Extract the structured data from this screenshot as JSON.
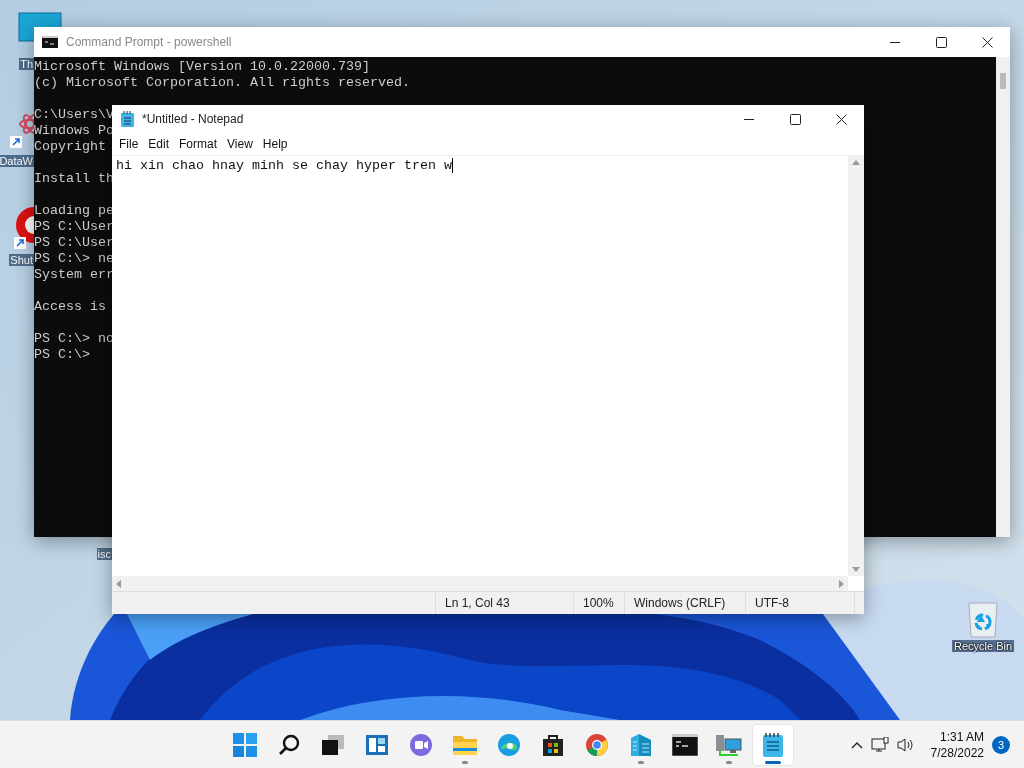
{
  "desktop_icons": [
    {
      "kind": "monitor",
      "label": "Th"
    },
    {
      "kind": "atom",
      "label": "DataW"
    },
    {
      "kind": "shutdown",
      "label": "Shut"
    },
    {
      "kind": "none",
      "label": "isc"
    },
    {
      "kind": "recycle",
      "label": "Recycle Bin"
    }
  ],
  "console_window": {
    "title": "Command Prompt - powershell",
    "blocks": [
      [
        "Microsoft Windows [Version 10.0.22000.739]",
        "(c) Microsoft Corporation. All rights reserved."
      ],
      [
        "C:\\Users\\V",
        "Windows Po",
        "Copyright"
      ],
      [
        "Install th"
      ],
      [
        "Loading pe",
        "PS C:\\User",
        "PS C:\\User",
        "PS C:\\> ne",
        "System err"
      ],
      [
        "Access is"
      ],
      [
        "PS C:\\> no",
        "PS C:\\>"
      ]
    ]
  },
  "notepad": {
    "title": "*Untitled - Notepad",
    "menu": [
      "File",
      "Edit",
      "Format",
      "View",
      "Help"
    ],
    "text": "hi xin chao hnay minh se chay hyper tren w",
    "status_bar": [
      "Ln 1, Col 43",
      "100%",
      "Windows (CRLF)",
      "UTF-8"
    ]
  },
  "taskbar": {
    "items": [
      {
        "kind": "start",
        "running": false,
        "active": false
      },
      {
        "kind": "search",
        "running": false,
        "active": false
      },
      {
        "kind": "taskview",
        "running": false,
        "active": false
      },
      {
        "kind": "widgets",
        "running": false,
        "active": false
      },
      {
        "kind": "chat",
        "running": false,
        "active": false
      },
      {
        "kind": "explorer",
        "running": true,
        "active": false
      },
      {
        "kind": "edge",
        "running": false,
        "active": false
      },
      {
        "kind": "store",
        "running": false,
        "active": false
      },
      {
        "kind": "chrome",
        "running": false,
        "active": false
      },
      {
        "kind": "buildings",
        "running": true,
        "active": false
      },
      {
        "kind": "terminal",
        "running": false,
        "active": false
      },
      {
        "kind": "network",
        "running": true,
        "active": false
      },
      {
        "kind": "notepad",
        "running": true,
        "active": true
      }
    ],
    "time": "1:31 AM",
    "date": "7/28/2022",
    "notifications": "3"
  }
}
